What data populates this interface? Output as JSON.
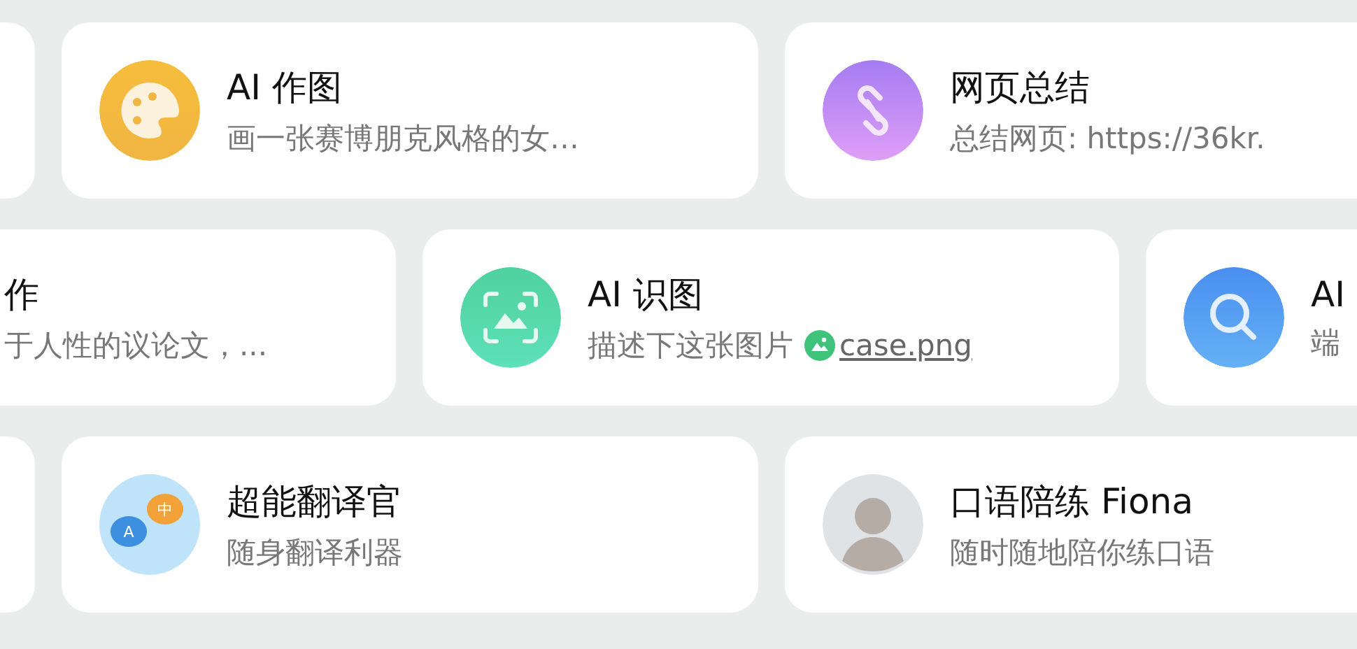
{
  "rows": [
    {
      "cards": [
        {
          "kind": "blank"
        },
        {
          "kind": "palette",
          "title": "AI 作图",
          "subtitle": "画一张赛博朋克风格的女…"
        },
        {
          "kind": "link",
          "title": "网页总结",
          "subtitle": "总结网页: https://36kr."
        }
      ]
    },
    {
      "cards": [
        {
          "kind": "text",
          "title": "作",
          "subtitle": "于人性的议论文，..."
        },
        {
          "kind": "scan",
          "title": "AI 识图",
          "subtitle": "描述下这张图片",
          "attachment": "case.png"
        },
        {
          "kind": "search",
          "title": "AI",
          "subtitle": "端"
        }
      ]
    },
    {
      "cards": [
        {
          "kind": "blank"
        },
        {
          "kind": "translate",
          "icon_labels": [
            "A",
            "中"
          ],
          "title": "超能翻译官",
          "subtitle": "随身翻译利器"
        },
        {
          "kind": "avatar",
          "title": "口语陪练 Fiona",
          "subtitle": "随时随地陪你练口语"
        }
      ]
    }
  ]
}
